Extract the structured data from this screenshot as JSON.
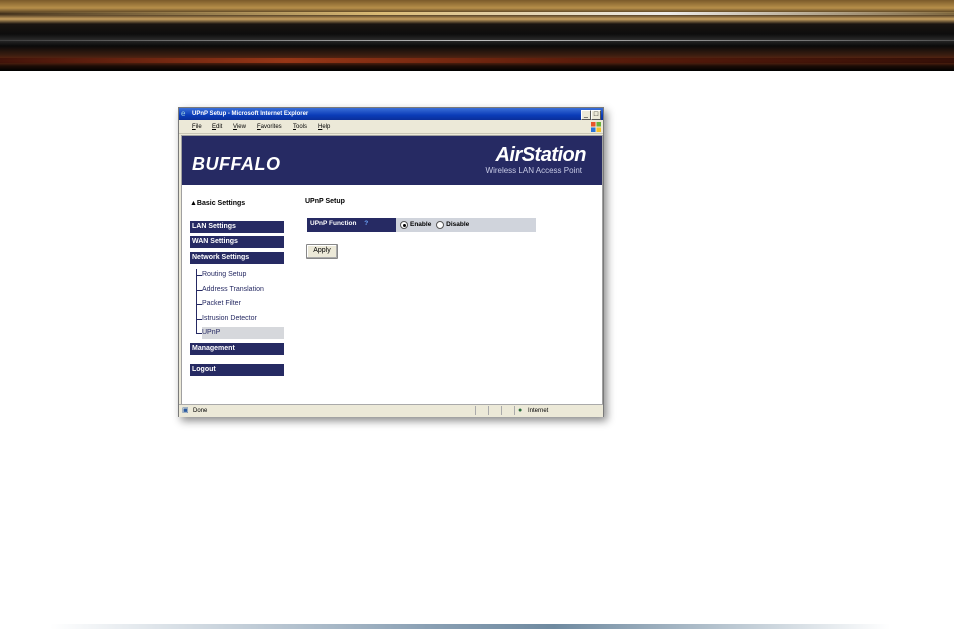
{
  "window": {
    "title": "UPnP Setup - Microsoft Internet Explorer",
    "minimize_glyph": "_",
    "maximize_glyph": "□"
  },
  "menubar": {
    "items": [
      "File",
      "Edit",
      "View",
      "Favorites",
      "Tools",
      "Help"
    ]
  },
  "header": {
    "brand": "BUFFALO",
    "product": "AirStation",
    "subtitle": "Wireless LAN Access Point",
    "background_color": "#262a63"
  },
  "sidebar": {
    "basic_settings": "▲Basic Settings",
    "sections": [
      "LAN Settings",
      "WAN Settings",
      "Network Settings"
    ],
    "sub_items": [
      "Routing Setup",
      "Address Translation",
      "Packet Filter",
      "Istrusion Detector",
      "UPnP"
    ],
    "active_sub_item": "UPnP",
    "bottom_sections": [
      "Management",
      "Logout"
    ]
  },
  "main": {
    "section_title": "UPnP Setup",
    "function_label": "UPnP Function",
    "help_glyph": "?",
    "options": [
      "Enable",
      "Disable"
    ],
    "selected_option": "Enable",
    "apply_label": "Apply"
  },
  "statusbar": {
    "status": "Done",
    "zone": "Internet"
  }
}
